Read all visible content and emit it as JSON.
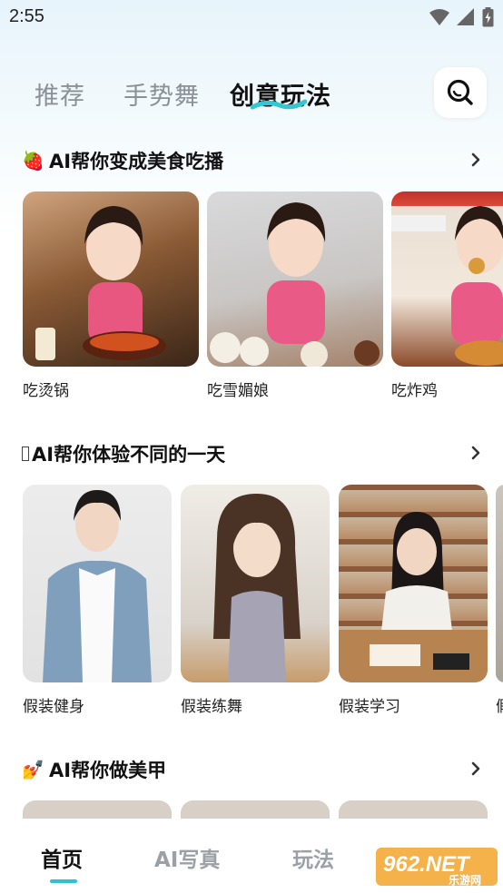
{
  "status": {
    "time": "2:55"
  },
  "tabs": [
    {
      "label": "推荐"
    },
    {
      "label": "手势舞"
    },
    {
      "label": "创意玩法"
    }
  ],
  "sections": [
    {
      "emoji": "🍓",
      "title": "AI帮你变成美食吃播",
      "cards": [
        {
          "label": "吃烫锅"
        },
        {
          "label": "吃雪媚娘"
        },
        {
          "label": "吃炸鸡"
        }
      ]
    },
    {
      "emoji": "",
      "title": "AI帮你体验不同的一天",
      "cards": [
        {
          "label": "假装健身"
        },
        {
          "label": "假装练舞"
        },
        {
          "label": "假装学习"
        },
        {
          "label": "假"
        }
      ]
    },
    {
      "emoji": "💅",
      "title": "AI帮你做美甲",
      "cards": []
    }
  ],
  "bottom_nav": [
    {
      "label": "首页"
    },
    {
      "label": "AI写真"
    },
    {
      "label": "玩法"
    }
  ],
  "watermark": {
    "text": "962.NET",
    "sub": "乐游网"
  },
  "colors": {
    "accent": "#2bc5d1",
    "active_text": "#111111",
    "inactive_text": "#8a9096"
  }
}
